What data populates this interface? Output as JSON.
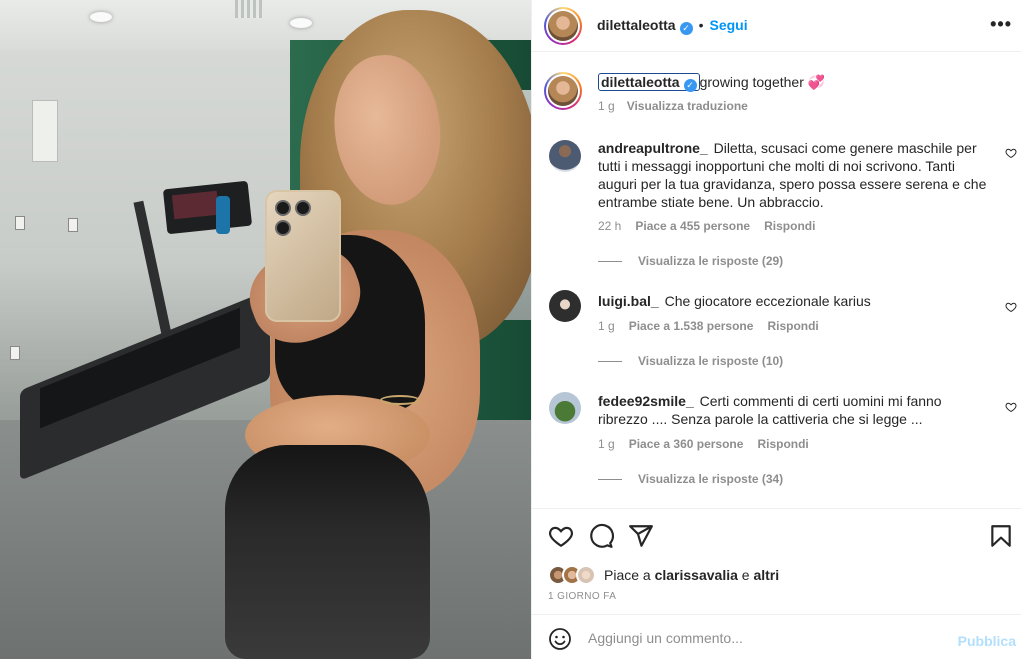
{
  "colors": {
    "link": "#0095f6",
    "verified": "#3897f0",
    "muted": "#8e8e8e",
    "text": "#262626",
    "publish_disabled": "#b2dffc",
    "focus_ring": "#1b4a91"
  },
  "header": {
    "username": "dilettaleotta",
    "separator": "•",
    "follow_label": "Segui",
    "more_icon": "ellipsis-icon"
  },
  "caption": {
    "username": "dilettaleotta",
    "text": "growing together 💞",
    "age": "1 g",
    "translate_label": "Visualizza traduzione"
  },
  "comments": [
    {
      "username": "andreapultrone_",
      "text": "Diletta, scusaci come genere maschile per tutti i messaggi inopportuni che molti di noi scrivono. Tanti auguri per la tua gravidanza, spero possa essere serena e che entrambe stiate bene. Un abbraccio.",
      "age": "22 h",
      "likes": "Piace a 455 persone",
      "reply_label": "Rispondi",
      "view_replies": "Visualizza le risposte (29)"
    },
    {
      "username": "luigi.bal_",
      "text": "Che giocatore eccezionale karius",
      "age": "1 g",
      "likes": "Piace a 1.538 persone",
      "reply_label": "Rispondi",
      "view_replies": "Visualizza le risposte (10)"
    },
    {
      "username": "fedee92smile_",
      "text": "Certi commenti di certi uomini mi fanno ribrezzo .... Senza parole la cattiveria che si legge ...",
      "age": "1 g",
      "likes": "Piace a 360 persone",
      "reply_label": "Rispondi",
      "view_replies": "Visualizza le risposte (34)"
    }
  ],
  "actions": {
    "like_icon": "heart-icon",
    "comment_icon": "comment-bubble-icon",
    "share_icon": "paper-plane-icon",
    "save_icon": "bookmark-icon",
    "likes_prefix": "Piace a",
    "likes_user": "clarissavalia",
    "likes_conj": "e",
    "likes_others": "altri",
    "date": "1 GIORNO FA"
  },
  "composer": {
    "placeholder": "Aggiungi un commento...",
    "publish_label": "Pubblica",
    "emoji_icon": "smiley-icon"
  }
}
